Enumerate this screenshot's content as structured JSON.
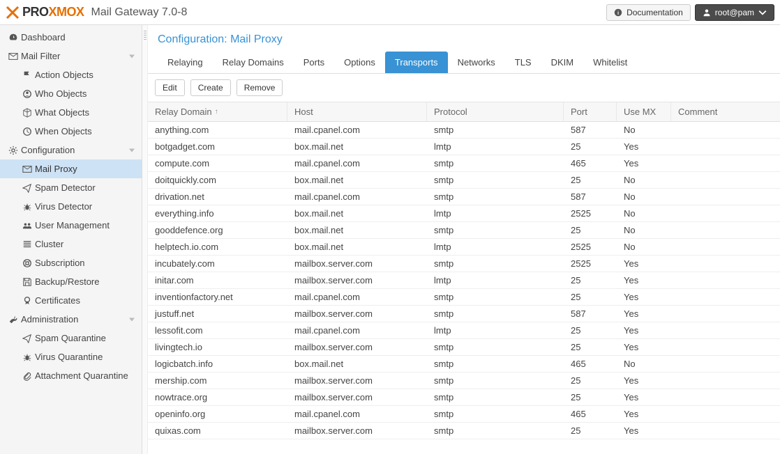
{
  "header": {
    "brand_1": "PRO",
    "brand_2": "XMOX",
    "app_title": "Mail Gateway 7.0-8",
    "doc_label": "Documentation",
    "user_label": "root@pam"
  },
  "sidebar": [
    {
      "id": "dashboard",
      "label": "Dashboard",
      "icon": "tach",
      "section": true
    },
    {
      "id": "mail-filter",
      "label": "Mail Filter",
      "icon": "envelope",
      "section": true,
      "expandable": true
    },
    {
      "id": "action-objects",
      "label": "Action Objects",
      "icon": "flag",
      "child": true
    },
    {
      "id": "who-objects",
      "label": "Who Objects",
      "icon": "user-circle",
      "child": true
    },
    {
      "id": "what-objects",
      "label": "What Objects",
      "icon": "cube",
      "child": true
    },
    {
      "id": "when-objects",
      "label": "When Objects",
      "icon": "clock",
      "child": true
    },
    {
      "id": "configuration",
      "label": "Configuration",
      "icon": "cogs",
      "section": true,
      "expandable": true
    },
    {
      "id": "mail-proxy",
      "label": "Mail Proxy",
      "icon": "mail",
      "child": true,
      "selected": true
    },
    {
      "id": "spam-detector",
      "label": "Spam Detector",
      "icon": "paper-plane",
      "child": true
    },
    {
      "id": "virus-detector",
      "label": "Virus Detector",
      "icon": "bug",
      "child": true
    },
    {
      "id": "user-management",
      "label": "User Management",
      "icon": "users",
      "child": true
    },
    {
      "id": "cluster",
      "label": "Cluster",
      "icon": "list",
      "child": true
    },
    {
      "id": "subscription",
      "label": "Subscription",
      "icon": "life-ring",
      "child": true
    },
    {
      "id": "backup-restore",
      "label": "Backup/Restore",
      "icon": "save",
      "child": true
    },
    {
      "id": "certificates",
      "label": "Certificates",
      "icon": "certificate",
      "child": true
    },
    {
      "id": "administration",
      "label": "Administration",
      "icon": "wrench",
      "section": true,
      "expandable": true
    },
    {
      "id": "spam-quarantine",
      "label": "Spam Quarantine",
      "icon": "paper-plane",
      "child": true
    },
    {
      "id": "virus-quarantine",
      "label": "Virus Quarantine",
      "icon": "bug",
      "child": true
    },
    {
      "id": "attachment-quarantine",
      "label": "Attachment Quarantine",
      "icon": "paperclip",
      "child": true
    }
  ],
  "content": {
    "title": "Configuration: Mail Proxy",
    "tabs": [
      {
        "id": "relaying",
        "label": "Relaying"
      },
      {
        "id": "relay-domains",
        "label": "Relay Domains"
      },
      {
        "id": "ports",
        "label": "Ports"
      },
      {
        "id": "options",
        "label": "Options"
      },
      {
        "id": "transports",
        "label": "Transports",
        "active": true
      },
      {
        "id": "networks",
        "label": "Networks"
      },
      {
        "id": "tls",
        "label": "TLS"
      },
      {
        "id": "dkim",
        "label": "DKIM"
      },
      {
        "id": "whitelist",
        "label": "Whitelist"
      }
    ],
    "toolbar": {
      "edit": "Edit",
      "create": "Create",
      "remove": "Remove"
    },
    "columns": {
      "domain": "Relay Domain",
      "host": "Host",
      "protocol": "Protocol",
      "port": "Port",
      "usemx": "Use MX",
      "comment": "Comment",
      "sort_indicator": "↑"
    },
    "rows": [
      {
        "domain": "anything.com",
        "host": "mail.cpanel.com",
        "protocol": "smtp",
        "port": "587",
        "usemx": "No",
        "comment": ""
      },
      {
        "domain": "botgadget.com",
        "host": "box.mail.net",
        "protocol": "lmtp",
        "port": "25",
        "usemx": "Yes",
        "comment": ""
      },
      {
        "domain": "compute.com",
        "host": "mail.cpanel.com",
        "protocol": "smtp",
        "port": "465",
        "usemx": "Yes",
        "comment": ""
      },
      {
        "domain": "doitquickly.com",
        "host": "box.mail.net",
        "protocol": "smtp",
        "port": "25",
        "usemx": "No",
        "comment": ""
      },
      {
        "domain": "drivation.net",
        "host": "mail.cpanel.com",
        "protocol": "smtp",
        "port": "587",
        "usemx": "No",
        "comment": ""
      },
      {
        "domain": "everything.info",
        "host": "box.mail.net",
        "protocol": "lmtp",
        "port": "2525",
        "usemx": "No",
        "comment": ""
      },
      {
        "domain": "gooddefence.org",
        "host": "box.mail.net",
        "protocol": "smtp",
        "port": "25",
        "usemx": "No",
        "comment": ""
      },
      {
        "domain": "helptech.io.com",
        "host": "box.mail.net",
        "protocol": "lmtp",
        "port": "2525",
        "usemx": "No",
        "comment": ""
      },
      {
        "domain": "incubately.com",
        "host": "mailbox.server.com",
        "protocol": "smtp",
        "port": "2525",
        "usemx": "Yes",
        "comment": ""
      },
      {
        "domain": "initar.com",
        "host": "mailbox.server.com",
        "protocol": "lmtp",
        "port": "25",
        "usemx": "Yes",
        "comment": ""
      },
      {
        "domain": "inventionfactory.net",
        "host": "mail.cpanel.com",
        "protocol": "smtp",
        "port": "25",
        "usemx": "Yes",
        "comment": ""
      },
      {
        "domain": "justuff.net",
        "host": "mailbox.server.com",
        "protocol": "smtp",
        "port": "587",
        "usemx": "Yes",
        "comment": ""
      },
      {
        "domain": "lessofit.com",
        "host": "mail.cpanel.com",
        "protocol": "lmtp",
        "port": "25",
        "usemx": "Yes",
        "comment": ""
      },
      {
        "domain": "livingtech.io",
        "host": "mailbox.server.com",
        "protocol": "smtp",
        "port": "25",
        "usemx": "Yes",
        "comment": ""
      },
      {
        "domain": "logicbatch.info",
        "host": "box.mail.net",
        "protocol": "smtp",
        "port": "465",
        "usemx": "No",
        "comment": ""
      },
      {
        "domain": "mership.com",
        "host": "mailbox.server.com",
        "protocol": "smtp",
        "port": "25",
        "usemx": "Yes",
        "comment": ""
      },
      {
        "domain": "nowtrace.org",
        "host": "mailbox.server.com",
        "protocol": "smtp",
        "port": "25",
        "usemx": "Yes",
        "comment": ""
      },
      {
        "domain": "openinfo.org",
        "host": "mail.cpanel.com",
        "protocol": "smtp",
        "port": "465",
        "usemx": "Yes",
        "comment": ""
      },
      {
        "domain": "quixas.com",
        "host": "mailbox.server.com",
        "protocol": "smtp",
        "port": "25",
        "usemx": "Yes",
        "comment": ""
      }
    ]
  }
}
